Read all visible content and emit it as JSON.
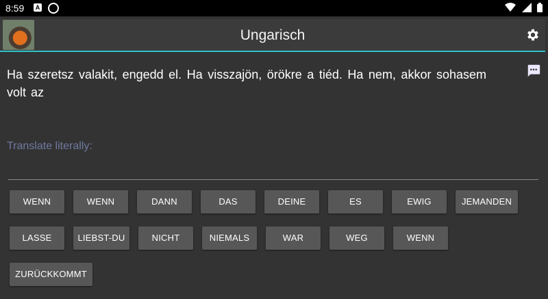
{
  "status_bar": {
    "time": "8:59",
    "icons": [
      "notification-a-icon",
      "sync-icon",
      "wifi-icon",
      "signal-icon",
      "battery-icon"
    ]
  },
  "app_bar": {
    "title": "Ungarisch",
    "accent_color": "#2ec4c9",
    "settings_icon": "gear-icon"
  },
  "exercise": {
    "sentence": "Ha szeretsz valakit, engedd el. Ha visszajön, örökre a tiéd. Ha nem, akkor sohasem volt az",
    "prompt": "Translate literally:",
    "word_chips": [
      "WENN",
      "WENN",
      "DANN",
      "DAS",
      "DEINE",
      "ES",
      "EWIG",
      "JEMANDEN",
      "LASSE",
      "LIEBST-DU",
      "NICHT",
      "NIEMALS",
      "WAR",
      "WEG",
      "WENN",
      "ZURÜCKKOMMT"
    ]
  },
  "colors": {
    "background": "#333333",
    "app_bar": "#3b3b3b",
    "chip": "#575757",
    "prompt_text": "#6f7aa0"
  }
}
